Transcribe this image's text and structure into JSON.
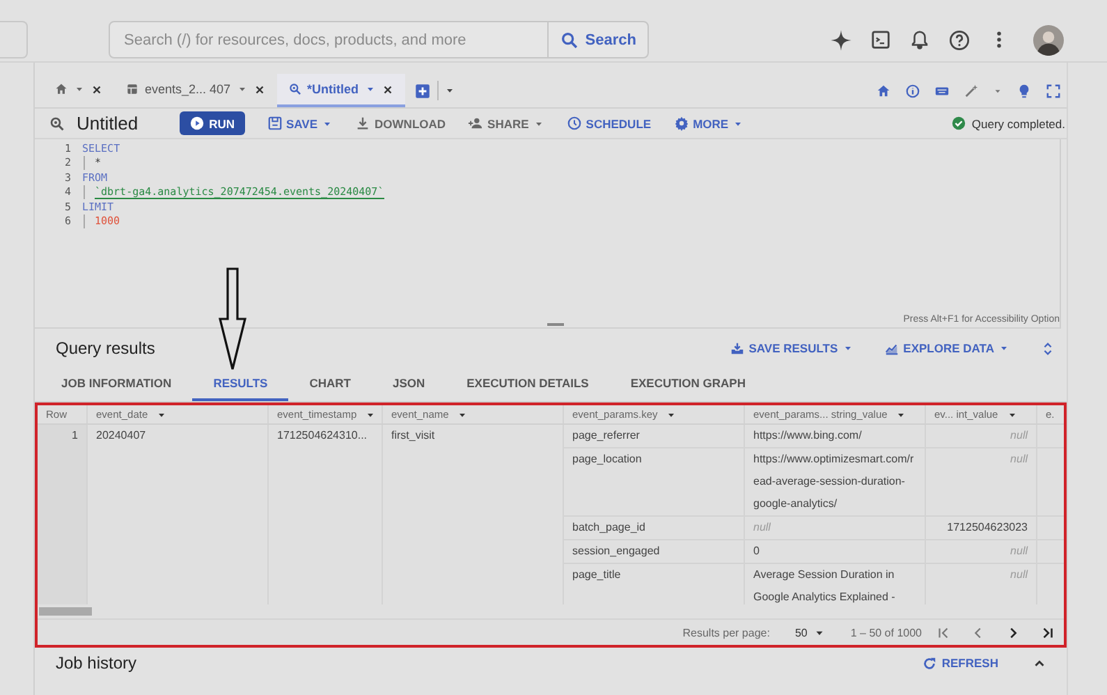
{
  "top_bar": {
    "search": {
      "placeholder": "Search (/) for resources, docs, products, and more"
    },
    "search_button": "Search"
  },
  "editor_tabs": [
    {
      "kind": "home",
      "selected": false
    },
    {
      "kind": "table",
      "label": "events_2... 407",
      "selected": false
    },
    {
      "kind": "query",
      "label": "*Untitled",
      "selected": true
    }
  ],
  "query_title": "Untitled",
  "toolbar": [
    {
      "kind": "run",
      "label": "RUN",
      "dropdown": false
    },
    {
      "kind": "save",
      "label": "SAVE",
      "dropdown": true
    },
    {
      "kind": "download",
      "label": "DOWNLOAD",
      "dropdown": false
    },
    {
      "kind": "share",
      "label": "SHARE",
      "dropdown": true
    },
    {
      "kind": "schedule",
      "label": "SCHEDULE",
      "dropdown": false
    },
    {
      "kind": "more",
      "label": "MORE",
      "dropdown": true
    }
  ],
  "status": "Query completed.",
  "code": [
    {
      "number": "1",
      "indent": false,
      "tokens": [
        {
          "text": "SELECT",
          "kind": "keyword"
        }
      ]
    },
    {
      "number": "2",
      "indent": true,
      "tokens": [
        {
          "text": "*",
          "kind": "plain"
        }
      ]
    },
    {
      "number": "3",
      "indent": false,
      "tokens": [
        {
          "text": "FROM",
          "kind": "keyword"
        }
      ]
    },
    {
      "number": "4",
      "indent": true,
      "tokens": [
        {
          "text": "`dbrt-ga4.analytics_207472454.events_20240407`",
          "kind": "string"
        }
      ]
    },
    {
      "number": "5",
      "indent": false,
      "tokens": [
        {
          "text": "LIMIT",
          "kind": "keyword"
        }
      ]
    },
    {
      "number": "6",
      "indent": true,
      "tokens": [
        {
          "text": "1000",
          "kind": "number"
        }
      ]
    }
  ],
  "accessibility_hint": "Press Alt+F1 for Accessibility Option",
  "results": {
    "title": "Query results",
    "actions": [
      {
        "kind": "save",
        "label": "SAVE RESULTS"
      },
      {
        "kind": "explore",
        "label": "EXPLORE DATA"
      }
    ],
    "tabs": [
      {
        "label": "JOB INFORMATION",
        "selected": false
      },
      {
        "label": "RESULTS",
        "selected": true
      },
      {
        "label": "CHART",
        "selected": false
      },
      {
        "label": "JSON",
        "selected": false
      },
      {
        "label": "EXECUTION DETAILS",
        "selected": false
      },
      {
        "label": "EXECUTION GRAPH",
        "selected": false
      }
    ],
    "table": {
      "columns": [
        {
          "label": "Row",
          "menu": false
        },
        {
          "label": "event_date",
          "menu": true
        },
        {
          "label": "event_timestamp",
          "menu": true
        },
        {
          "label": "event_name",
          "menu": true
        },
        {
          "label": "event_params.key",
          "menu": true
        },
        {
          "label": "event_params... string_value",
          "menu": true
        },
        {
          "label": "ev... int_value",
          "menu": true
        },
        {
          "label": "e.",
          "menu": false
        }
      ],
      "rows": [
        {
          "row": "1",
          "event_date": "20240407",
          "event_timestamp": "1712504624310...",
          "event_name": "first_visit",
          "params": [
            {
              "key": "page_referrer",
              "string_value": {
                "text": "https://www.bing.com/",
                "null": false
              },
              "int_value": {
                "text": "null",
                "null": true
              }
            },
            {
              "key": "page_location",
              "string_value": {
                "text": "https://www.optimizesmart.com/read-average-session-duration-google-analytics/",
                "null": false
              },
              "int_value": {
                "text": "null",
                "null": true
              }
            },
            {
              "key": "batch_page_id",
              "string_value": {
                "text": "null",
                "null": true
              },
              "int_value": {
                "text": "1712504623023",
                "null": false
              }
            },
            {
              "key": "session_engaged",
              "string_value": {
                "text": "0",
                "null": false
              },
              "int_value": {
                "text": "null",
                "null": true
              }
            },
            {
              "key": "page_title",
              "string_value": {
                "text": "Average Session Duration in Google Analytics Explained -",
                "null": false
              },
              "int_value": {
                "text": "null",
                "null": true
              }
            }
          ]
        }
      ]
    },
    "pagination": {
      "label": "Results per page:",
      "per_page": "50",
      "range": "1 – 50 of 1000"
    }
  },
  "job_history": {
    "title": "Job history",
    "refresh": "REFRESH"
  }
}
